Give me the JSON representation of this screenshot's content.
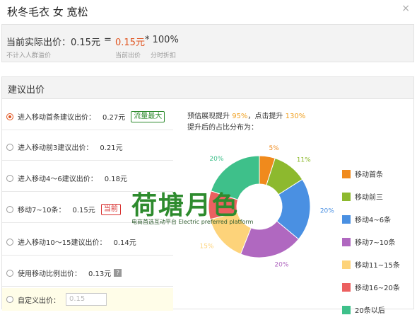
{
  "window": {
    "title": "秋冬毛衣 女 宽松",
    "close_glyph": "×"
  },
  "summary": {
    "actual_label": "当前实际出价：0.15元",
    "equals": "=",
    "current_bid": "0.15元",
    "multiplier": "* 100%",
    "note_actual": "不计入人群溢价",
    "note_current": "当前出价",
    "note_discount": "分时折扣"
  },
  "suggest": {
    "header": "建议出价",
    "options": [
      {
        "label": "进入移动首条建议出价：",
        "price": "0.27元",
        "badge": "流量最大",
        "badge_color": "green",
        "selected": true
      },
      {
        "label": "进入移动前3建议出价：",
        "price": "0.21元",
        "badge": "",
        "selected": false
      },
      {
        "label": "进入移动4～6建议出价：",
        "price": "0.18元",
        "badge": "",
        "selected": false
      },
      {
        "label": "移动7~10条：",
        "price": "0.15元",
        "badge": "当前",
        "badge_color": "red",
        "selected": false
      },
      {
        "label": "进入移动10～15建议出价：",
        "price": "0.14元",
        "badge": "",
        "selected": false
      },
      {
        "label": "使用移动比例出价：",
        "price": "0.13元",
        "badge": "",
        "selected": false,
        "has_help": true
      },
      {
        "label": "自定义出价：",
        "input_value": "0.15",
        "selected": false,
        "custom": true
      }
    ],
    "help_glyph": "?"
  },
  "chart_text": {
    "line1_pre": "预估展现提升",
    "line1_v1": "95%",
    "line1_mid": "，点击提升",
    "line1_v2": "130%",
    "line2": "提升后的占比分布为："
  },
  "watermark": {
    "logo": "荷塘月色",
    "sub": "电商首选互动平台 Electric preferred platform"
  },
  "chart_data": {
    "type": "pie",
    "donut": true,
    "slices": [
      {
        "label": "移动首条",
        "value": 5,
        "display": "5%",
        "color": "#f08a1c"
      },
      {
        "label": "移动前三",
        "value": 11,
        "display": "11%",
        "color": "#8db92e"
      },
      {
        "label": "移动4~6条",
        "value": 20,
        "display": "20%",
        "color": "#4a90e2"
      },
      {
        "label": "移动7~10条",
        "value": 20,
        "display": "20%",
        "color": "#b068c0"
      },
      {
        "label": "移动11~15条",
        "value": 15,
        "display": "15%",
        "color": "#fdd37a"
      },
      {
        "label": "移动16~20条",
        "value": 9,
        "display": "",
        "color": "#ec6060"
      },
      {
        "label": "20条以后",
        "value": 20,
        "display": "20%",
        "color": "#3ec08a"
      }
    ],
    "legend_position": "right"
  }
}
